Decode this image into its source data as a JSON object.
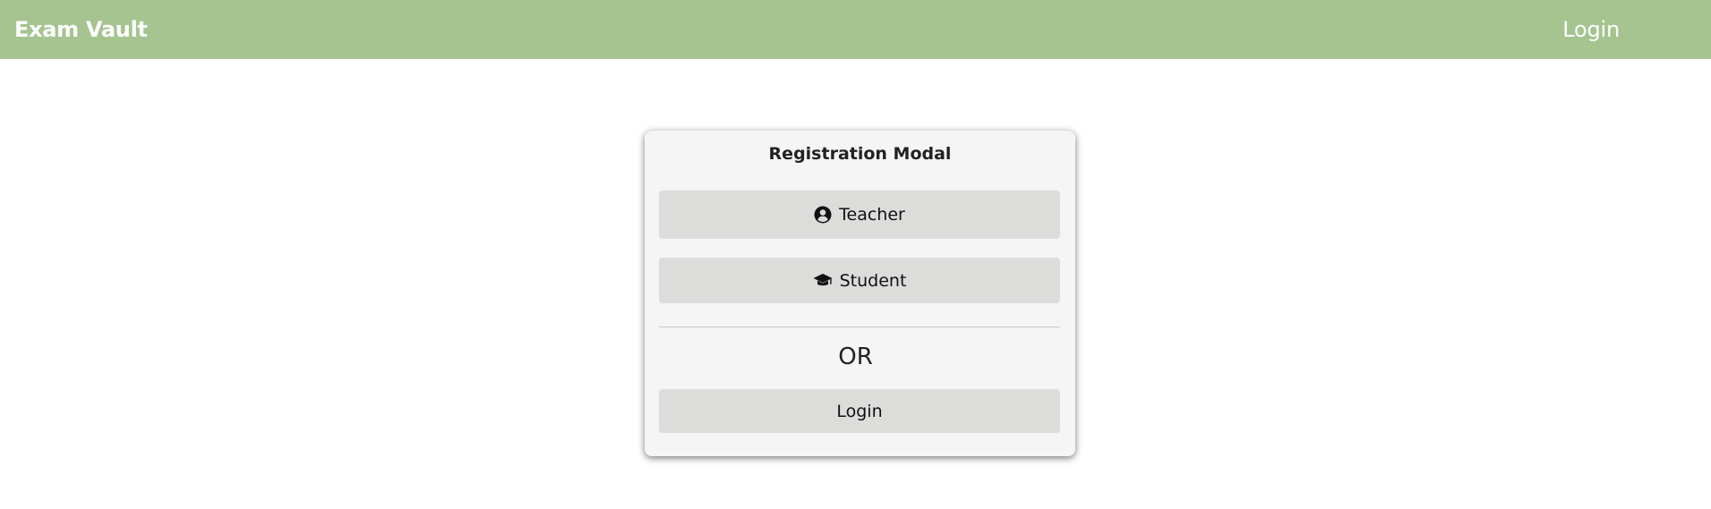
{
  "navbar": {
    "brand": "Exam Vault",
    "login_label": "Login"
  },
  "modal": {
    "title": "Registration Modal",
    "teacher_label": "Teacher",
    "teacher_icon": "user-circle-icon",
    "student_label": "Student",
    "student_icon": "graduation-cap-icon",
    "or_text": "OR",
    "login_label": "Login"
  },
  "colors": {
    "navbar_bg": "#a5c490",
    "modal_bg": "#f5f5f5",
    "button_bg": "#dcdcdb"
  }
}
